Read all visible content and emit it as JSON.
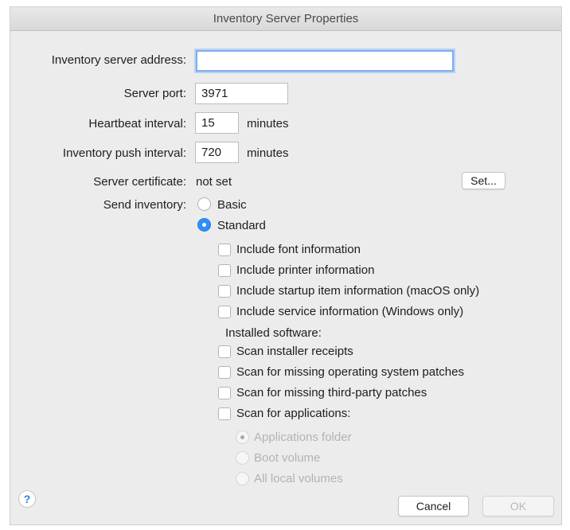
{
  "dialog": {
    "title": "Inventory Server Properties"
  },
  "labels": {
    "server_address": "Inventory server address:",
    "server_port": "Server port:",
    "heartbeat": "Heartbeat interval:",
    "push_interval": "Inventory push interval:",
    "certificate": "Server certificate:",
    "send_inventory": "Send inventory:"
  },
  "fields": {
    "server_address": "",
    "server_port": "3971",
    "heartbeat": "15",
    "push_interval": "720"
  },
  "units": {
    "heartbeat": "minutes",
    "push_interval": "minutes"
  },
  "certificate": {
    "value": "not set",
    "set_button": "Set..."
  },
  "send_inventory": {
    "options": [
      {
        "label": "Basic",
        "selected": false
      },
      {
        "label": "Standard",
        "selected": true
      }
    ]
  },
  "standard_options": [
    {
      "label": "Include font information",
      "checked": false
    },
    {
      "label": "Include printer information",
      "checked": false
    },
    {
      "label": "Include startup item information (macOS only)",
      "checked": false
    },
    {
      "label": "Include service information (Windows only)",
      "checked": false
    }
  ],
  "installed_software": {
    "heading": "Installed software:",
    "options": [
      {
        "label": "Scan installer receipts",
        "checked": false
      },
      {
        "label": "Scan for missing operating system patches",
        "checked": false
      },
      {
        "label": "Scan for missing third-party patches",
        "checked": false
      },
      {
        "label": "Scan for applications:",
        "checked": false
      }
    ]
  },
  "scan_locations": {
    "enabled": false,
    "options": [
      {
        "label": "Applications folder",
        "selected": true
      },
      {
        "label": "Boot volume",
        "selected": false
      },
      {
        "label": "All local volumes",
        "selected": false
      }
    ]
  },
  "footer": {
    "help": "?",
    "cancel": "Cancel",
    "ok": "OK",
    "ok_enabled": false
  },
  "colors": {
    "accent": "#2f8ff7",
    "focus_ring": "#7eadef"
  }
}
